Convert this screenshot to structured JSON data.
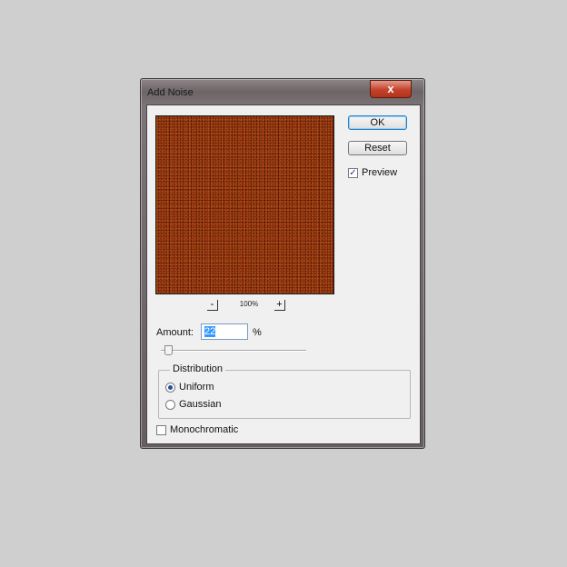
{
  "dialog": {
    "title": "Add Noise",
    "close_icon": "close-icon",
    "close_glyph": "x"
  },
  "preview": {
    "zoom_out": "-",
    "zoom_level": "100%",
    "zoom_in": "+"
  },
  "buttons": {
    "ok": "OK",
    "reset": "Reset"
  },
  "preview_toggle": {
    "label": "Preview",
    "checked": true,
    "check_glyph": "✓"
  },
  "amount": {
    "label": "Amount:",
    "value": "22",
    "unit": "%"
  },
  "distribution": {
    "title": "Distribution",
    "options": [
      {
        "label": "Uniform",
        "selected": true
      },
      {
        "label": "Gaussian",
        "selected": false
      }
    ]
  },
  "monochromatic": {
    "label": "Monochromatic",
    "checked": false
  },
  "colors": {
    "noise_base": "#8f2a10",
    "accent": "#3399ff",
    "close_button": "#c2422c"
  }
}
